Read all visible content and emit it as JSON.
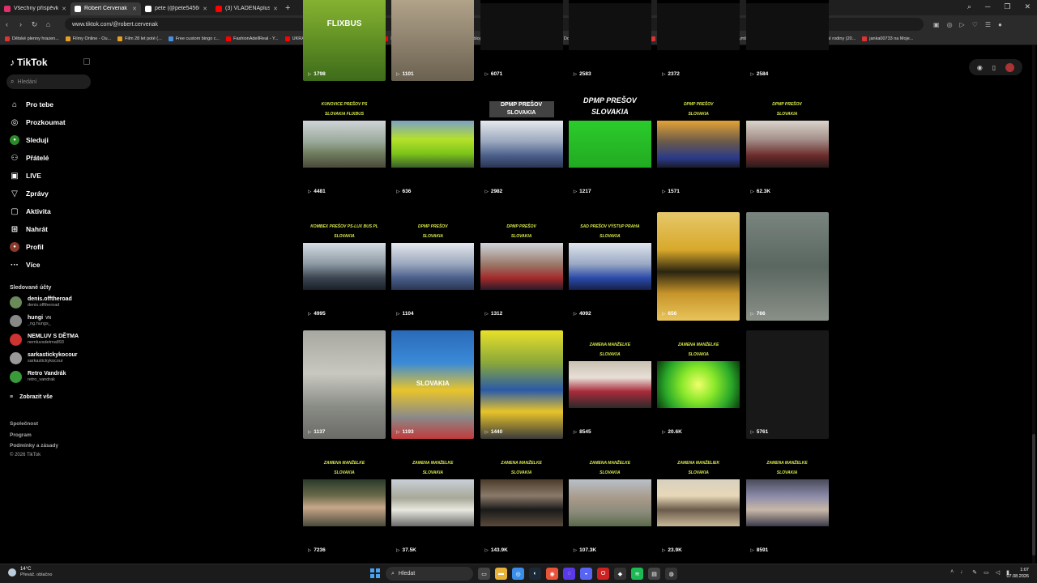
{
  "browser": {
    "tabs": [
      {
        "title": "Všechny příspěvky • Insta",
        "color": "#e1306c",
        "active": false
      },
      {
        "title": "Robert Cervenak (@rober",
        "color": "#ffffff",
        "active": true
      },
      {
        "title": "pete (@pete54560) | TikT",
        "color": "#ffffff",
        "active": false
      },
      {
        "title": "(3) VLADĚNAplus - YouTu",
        "color": "#ff0000",
        "active": false
      }
    ],
    "url": "www.tiktok.com/@robert.cervenak",
    "bookmarks": [
      {
        "label": "Dětské plenny hrazen...",
        "color": "#d33"
      },
      {
        "label": "Filmy Online - Ou...",
        "color": "#e8a020"
      },
      {
        "label": "Film 28 let poté (...",
        "color": "#e8a020"
      },
      {
        "label": "Free custom bingo c...",
        "color": "#4a90e2"
      },
      {
        "label": "FashionAdellReal - Y...",
        "color": "#ff0000"
      },
      {
        "label": "UKRAJINA V OHNI...",
        "color": "#ff0000"
      },
      {
        "label": "Movavi Effects",
        "color": "#ffffff"
      },
      {
        "label": "Nový Přítel Adély +...",
        "color": "#ff0000"
      },
      {
        "label": "Blog :: Fionin-blog",
        "color": "#999999"
      },
      {
        "label": "Černota | Stream",
        "color": "#999999"
      },
      {
        "label": "Kick VOD Download...",
        "color": "#53fc18"
      },
      {
        "label": "0307 (15)5.mp4 - M...",
        "color": "#999999"
      },
      {
        "label": "3D Gif Maker — Fre...",
        "color": "#d33"
      },
      {
        "label": "Facebook Symboly...",
        "color": "#d33"
      },
      {
        "label": "Hotel Paradise",
        "color": "#4a90e2"
      },
      {
        "label": "Extrémní rodiny (20...",
        "color": "#4a90e2"
      },
      {
        "label": "janka00733 na Moje...",
        "color": "#d33"
      }
    ]
  },
  "sidebar": {
    "logo": "TikTok",
    "search_placeholder": "Hledání",
    "nav": [
      {
        "label": "Pro tebe",
        "icon": "home-icon",
        "glyph": "⌂"
      },
      {
        "label": "Prozkoumat",
        "icon": "compass-icon",
        "glyph": "◎"
      },
      {
        "label": "Sleduji",
        "icon": "following-icon",
        "glyph": "●"
      },
      {
        "label": "Přátelé",
        "icon": "friends-icon",
        "glyph": "⚇"
      },
      {
        "label": "LIVE",
        "icon": "live-icon",
        "glyph": "▣"
      },
      {
        "label": "Zprávy",
        "icon": "messages-icon",
        "glyph": "▽"
      },
      {
        "label": "Aktivita",
        "icon": "activity-icon",
        "glyph": "▢"
      },
      {
        "label": "Nahrát",
        "icon": "upload-icon",
        "glyph": "⊞"
      },
      {
        "label": "Profil",
        "icon": "profile-icon",
        "glyph": "●"
      },
      {
        "label": "Více",
        "icon": "more-icon",
        "glyph": "···"
      }
    ],
    "following_title": "Sledované účty",
    "following": [
      {
        "name": "denis.offtheroad",
        "handle": "denis.offtheroad",
        "color": "#6a8a5a"
      },
      {
        "name": "hungi",
        "badge": "VN",
        "handle": "_ng.hungs_",
        "color": "#888888"
      },
      {
        "name": "NEMLUV S DĚTMA",
        "handle": "nemluvsdetma893",
        "color": "#c33"
      },
      {
        "name": "sarkastickykocour",
        "handle": "sarkastickykocour",
        "color": "#999999"
      },
      {
        "name": "Retro Vandrák",
        "handle": "retro_vandrak",
        "color": "#3a9a3a"
      }
    ],
    "show_all": "Zobrazit vše",
    "footer": [
      "Společnost",
      "Program",
      "Podmínky a zásady",
      "© 2026 TikTok"
    ]
  },
  "grid": {
    "rows": [
      [
        {
          "views": "1798",
          "caption": "FLIXBUS",
          "theme": "flixbus"
        },
        {
          "views": "1101",
          "caption": "",
          "theme": "blur-road"
        },
        {
          "views": "6071",
          "caption": "",
          "theme": "dark"
        },
        {
          "views": "2583",
          "caption": "",
          "theme": "dark"
        },
        {
          "views": "2372",
          "caption": "",
          "theme": "dark"
        },
        {
          "views": "2584",
          "caption": "",
          "theme": "dark"
        }
      ],
      [
        {
          "views": "4481",
          "caption": "KUNOVICE PREŠOV PS\nSLOVAKIA FLIXBUS",
          "theme": "window"
        },
        {
          "views": "636",
          "caption": "",
          "theme": "green-bus"
        },
        {
          "views": "2982",
          "caption": "DPMP PREŠOV\nSLOVAKIA",
          "theme": "bus-interior"
        },
        {
          "views": "1217",
          "caption": "DPMP PREŠOV\nSLOVAKIA",
          "theme": "subscribe"
        },
        {
          "views": "1571",
          "caption": "DPMP PREŠOV\nSLOVAKIA",
          "theme": "bus-seats"
        },
        {
          "views": "62.3K",
          "caption": "DPMP PREŠOV\nSLOVAKIA",
          "theme": "red-seats"
        }
      ],
      [
        {
          "views": "4995",
          "caption": "KOMBEX PREŠOV PS-LUX BUS PL\nSLOVAKIA",
          "theme": "coach"
        },
        {
          "views": "1104",
          "caption": "DPMP PREŠOV\nSLOVAKIA",
          "theme": "bus-interior"
        },
        {
          "views": "1312",
          "caption": "DPMP PREŠOV\nSLOVAKIA",
          "theme": "bus-red"
        },
        {
          "views": "4092",
          "caption": "SAD PREŠOV VÝSTUP PRAHA\nSLOVAKIA",
          "theme": "coach-blue"
        },
        {
          "views": "656",
          "caption": "",
          "theme": "sunset"
        },
        {
          "views": "766",
          "caption": "",
          "theme": "blur-grey"
        }
      ],
      [
        {
          "views": "1137",
          "caption": "",
          "theme": "blur-street"
        },
        {
          "views": "1193",
          "caption": "SLOVAKIA",
          "theme": "yellow-bus"
        },
        {
          "views": "1440",
          "caption": "",
          "theme": "yellow-bus2"
        },
        {
          "views": "8545",
          "caption": "ZAMENA MANŽELKE\nSLOVAKIA",
          "theme": "people"
        },
        {
          "views": "20.6K",
          "caption": "ZAMENA MANŽELKE\nSLOVAKIA",
          "theme": "green-logo"
        },
        {
          "views": "5761",
          "caption": "",
          "theme": "empty"
        }
      ],
      [
        {
          "views": "7236",
          "caption": "ZAMENA MANŽELKE\nSLOVAKIA",
          "theme": "man-drink"
        },
        {
          "views": "37.5K",
          "caption": "ZAMENA MANŽELKE\nSLOVAKIA",
          "theme": "house-car"
        },
        {
          "views": "143.9K",
          "caption": "ZAMENA MANŽELKE\nSLOVAKIA",
          "theme": "doorway"
        },
        {
          "views": "107.3K",
          "caption": "ZAMENA MANŽELKE\nSLOVAKIA",
          "theme": "house"
        },
        {
          "views": "23.9K",
          "caption": "ZAMENA MANŽELIEK\nSLOVAKIA",
          "theme": "kitchen"
        },
        {
          "views": "8591",
          "caption": "ZAMENA MANŽELKE\nSLOVAKIA",
          "theme": "sleeping"
        }
      ]
    ]
  },
  "taskbar": {
    "temp": "14°C",
    "weather": "Převáž. oblačno",
    "search": "Hledat",
    "time": "1:07",
    "date": "07.08.2026"
  }
}
